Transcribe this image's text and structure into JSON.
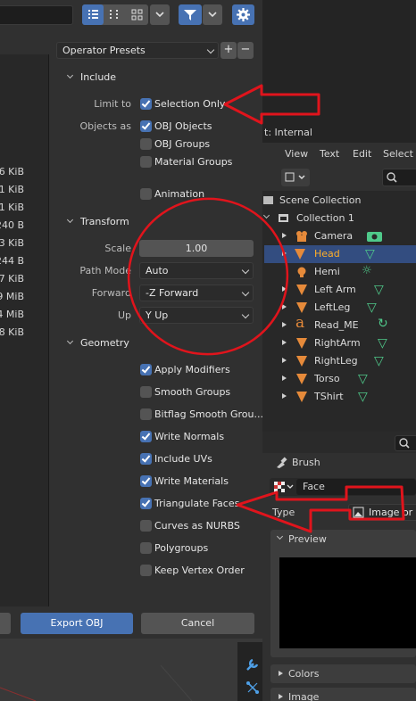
{
  "file_list": {
    "sizes": [
      "6 KiB",
      "1 KiB",
      "1 KiB",
      "240 B",
      "3 KiB",
      "244 B",
      "7 KiB",
      "9 MiB",
      "4 MiB",
      "8 KiB"
    ]
  },
  "operator_presets": {
    "label": "Operator Presets",
    "add": "+",
    "remove": "−"
  },
  "include": {
    "header": "Include",
    "limit_to_label": "Limit to",
    "selection_only": "Selection Only",
    "objects_as_label": "Objects as",
    "obj_objects": "OBJ Objects",
    "obj_groups": "OBJ Groups",
    "material_groups": "Material Groups",
    "animation": "Animation"
  },
  "transform": {
    "header": "Transform",
    "scale_label": "Scale",
    "scale_value": "1.00",
    "path_mode_label": "Path Mode",
    "path_mode_value": "Auto",
    "forward_label": "Forward",
    "forward_value": "-Z Forward",
    "up_label": "Up",
    "up_value": "Y Up"
  },
  "geometry": {
    "header": "Geometry",
    "options": [
      {
        "label": "Apply Modifiers",
        "checked": true
      },
      {
        "label": "Smooth Groups",
        "checked": false
      },
      {
        "label": "Bitflag Smooth Grou...",
        "checked": false
      },
      {
        "label": "Write Normals",
        "checked": true
      },
      {
        "label": "Include UVs",
        "checked": true
      },
      {
        "label": "Write Materials",
        "checked": true
      },
      {
        "label": "Triangulate Faces",
        "checked": true
      },
      {
        "label": "Curves as NURBS",
        "checked": false
      },
      {
        "label": "Polygroups",
        "checked": false
      },
      {
        "label": "Keep Vertex Order",
        "checked": false
      }
    ]
  },
  "footer": {
    "export_label": "Export OBJ",
    "cancel_label": "Cancel"
  },
  "text_editor": {
    "title_fragment": "t: Internal",
    "menu": [
      "View",
      "Text",
      "Edit",
      "Select"
    ]
  },
  "outliner": {
    "scene_collection": "Scene Collection",
    "collection": "Collection 1",
    "objects": [
      "Camera",
      "Head",
      "Hemi",
      "Left Arm",
      "LeftLeg",
      "Read_ME",
      "RightArm",
      "RightLeg",
      "Torso",
      "TShirt"
    ],
    "selected": "Head"
  },
  "properties": {
    "brush": "Brush",
    "face": "Face",
    "type_label": "Type",
    "type_value": "Image or M",
    "preview": "Preview",
    "colors": "Colors",
    "image": "Image"
  },
  "colors": {
    "accent": "#4772b3",
    "selected_row": "#334d80",
    "annotation": "#e0141c",
    "object_name_selected": "#ffaf29"
  }
}
